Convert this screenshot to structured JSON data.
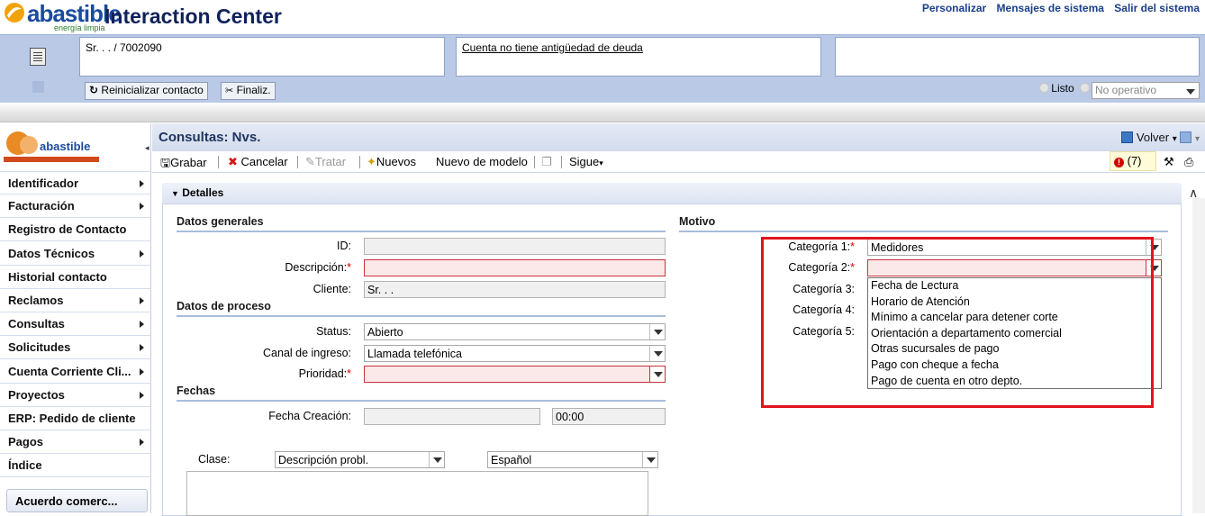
{
  "header": {
    "logo_text": "abastible",
    "logo_subtext": "energía limpia",
    "app_title": "Interaction Center",
    "links": [
      "Personalizar",
      "Mensajes de sistema",
      "Salir del sistema"
    ]
  },
  "context": {
    "customer": "Sr. . . / 7002090",
    "debt_notice": "Cuenta no tiene antigüedad de deuda",
    "extra": "",
    "reset_button": "Reinicializar contacto",
    "finalize_button": "Finaliz.",
    "status_ready": "Listo",
    "status_select": "No operativo"
  },
  "sidebar": {
    "logo_text": "abastible",
    "items": [
      {
        "label": "Identificador",
        "arrow": true
      },
      {
        "label": "Facturación",
        "arrow": true
      },
      {
        "label": "Registro de Contacto",
        "arrow": false
      },
      {
        "label": "Datos Técnicos",
        "arrow": true
      },
      {
        "label": "Historial contacto",
        "arrow": false
      },
      {
        "label": "Reclamos",
        "arrow": true
      },
      {
        "label": "Consultas",
        "arrow": true
      },
      {
        "label": "Solicitudes",
        "arrow": true
      },
      {
        "label": "Cuenta Corriente Cli...",
        "arrow": true
      },
      {
        "label": "Proyectos",
        "arrow": true
      },
      {
        "label": "ERP: Pedido de cliente",
        "arrow": false
      },
      {
        "label": "Pagos",
        "arrow": true
      },
      {
        "label": "Índice",
        "arrow": false
      }
    ],
    "agreement_button": "Acuerdo comerc..."
  },
  "main": {
    "title": "Consultas: Nvs.",
    "back": "Volver",
    "toolbar": {
      "save": "Grabar",
      "cancel": "Cancelar",
      "process": "Tratar",
      "new": "Nuevos",
      "new_template": "Nuevo de modelo",
      "more": "Sigue"
    },
    "messages_count": "(7)"
  },
  "details": {
    "section_label": "Detalles",
    "general": {
      "title": "Datos generales",
      "id_label": "ID:",
      "id_value": "",
      "description_label": "Descripción:",
      "description_value": "",
      "client_label": "Cliente:",
      "client_value": "Sr. . ."
    },
    "process": {
      "title": "Datos de proceso",
      "status_label": "Status:",
      "status_value": "Abierto",
      "channel_label": "Canal de ingreso:",
      "channel_value": "Llamada telefónica",
      "priority_label": "Prioridad:",
      "priority_value": ""
    },
    "dates": {
      "title": "Fechas",
      "creation_label": "Fecha Creación:",
      "creation_date": "",
      "creation_time": "00:00"
    },
    "text": {
      "class_label": "Clase:",
      "class_value": "Descripción probl.",
      "language_value": "Español"
    },
    "reason": {
      "title": "Motivo",
      "cat1_label": "Categoría 1:",
      "cat1_value": "Medidores",
      "cat2_label": "Categoría 2:",
      "cat2_value": "",
      "cat3_label": "Categoría 3:",
      "cat4_label": "Categoría 4:",
      "cat5_label": "Categoría 5:",
      "options": [
        "Fecha de Lectura",
        "Horario de Atención",
        "Mínimo a cancelar para detener corte",
        "Orientación a departamento comercial",
        "Otras sucursales de pago",
        "Pago con cheque a fecha",
        "Pago de cuenta en otro depto."
      ]
    }
  }
}
